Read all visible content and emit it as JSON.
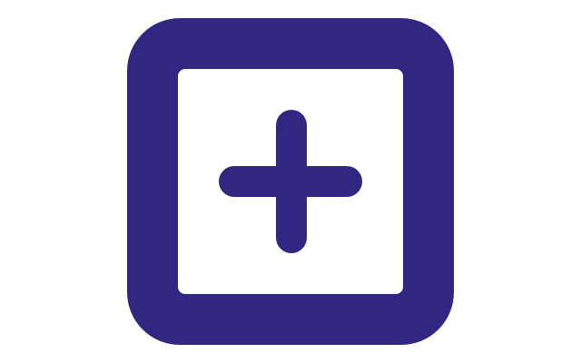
{
  "icon": {
    "name": "plus-square-icon",
    "color": "#312782",
    "background": "#ffffff"
  }
}
